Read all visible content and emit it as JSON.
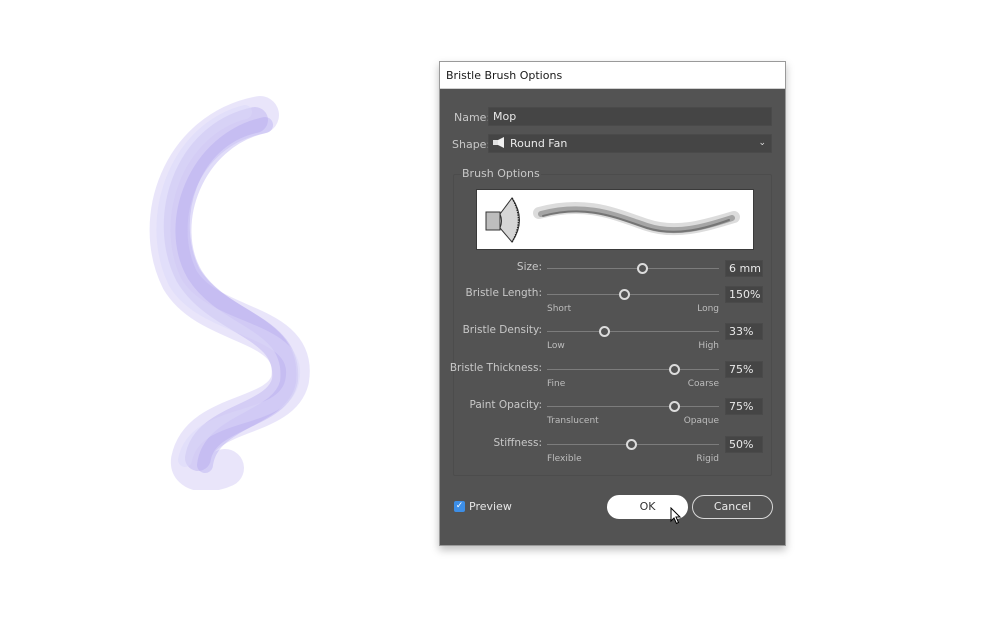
{
  "artboard": {
    "stroke_color": "#9d8fe6",
    "stroke_description": "bristle brush S-curve"
  },
  "dialog": {
    "title": "Bristle Brush Options",
    "name_label": "Name:",
    "name_value": "Mop",
    "shape_label": "Shape:",
    "shape_value": "Round Fan",
    "shape_icon": "round-fan-brush-icon",
    "group_title": "Brush Options",
    "sliders": [
      {
        "label": "Size:",
        "value": "6 mm",
        "position": 0.55,
        "min_label": "",
        "max_label": ""
      },
      {
        "label": "Bristle Length:",
        "value": "150%",
        "position": 0.45,
        "min_label": "Short",
        "max_label": "Long"
      },
      {
        "label": "Bristle Density:",
        "value": "33%",
        "position": 0.33,
        "min_label": "Low",
        "max_label": "High"
      },
      {
        "label": "Bristle Thickness:",
        "value": "75%",
        "position": 0.74,
        "min_label": "Fine",
        "max_label": "Coarse"
      },
      {
        "label": "Paint Opacity:",
        "value": "75%",
        "position": 0.74,
        "min_label": "Translucent",
        "max_label": "Opaque"
      },
      {
        "label": "Stiffness:",
        "value": "50%",
        "position": 0.49,
        "min_label": "Flexible",
        "max_label": "Rigid"
      }
    ],
    "preview_label": "Preview",
    "preview_checked": true,
    "ok_label": "OK",
    "cancel_label": "Cancel",
    "accent_color": "#3d8ee6"
  }
}
